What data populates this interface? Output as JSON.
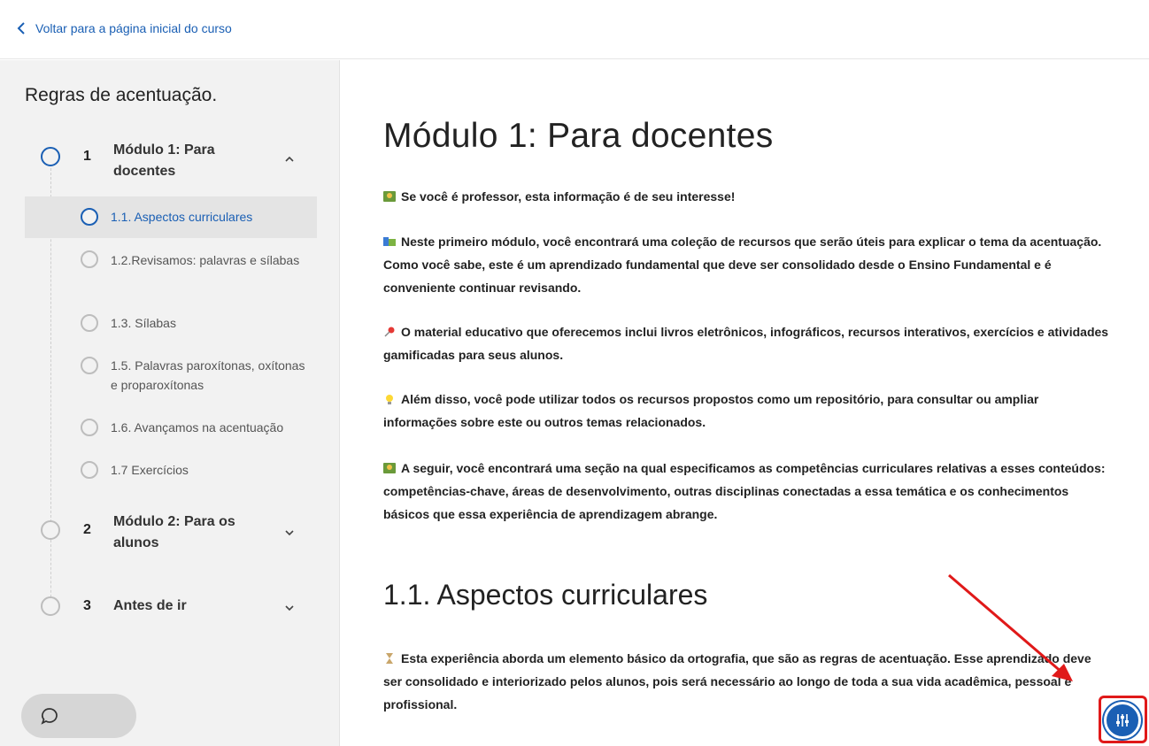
{
  "topbar": {
    "back_label": "Voltar para a página inicial do curso"
  },
  "sidebar": {
    "course_title": "Regras de acentuação.",
    "modules": [
      {
        "num": "1",
        "title": "Módulo 1: Para docentes",
        "expanded": true
      },
      {
        "num": "2",
        "title": "Módulo 2: Para os alunos",
        "expanded": false
      },
      {
        "num": "3",
        "title": "Antes de ir",
        "expanded": false
      }
    ],
    "lessons": [
      {
        "label": "1.1. Aspectos curriculares",
        "selected": true
      },
      {
        "label": "1.2.Revisamos: palavras e sílabas"
      },
      {
        "label": "1.3. Sílabas"
      },
      {
        "label": "1.5. Palavras paroxítonas, oxítonas e proparoxítonas"
      },
      {
        "label": "1.6. Avançamos na acentuação"
      },
      {
        "label": "1.7 Exercícios"
      }
    ]
  },
  "main": {
    "title": "Módulo 1: Para docentes",
    "paragraphs": [
      "Se você é professor, esta informação é de seu interesse!",
      "Neste primeiro módulo, você encontrará uma coleção de recursos que serão úteis para explicar o tema da acentuação. Como você sabe, este é um aprendizado fundamental que deve ser consolidado desde o Ensino Fundamental e é conveniente continuar revisando.",
      "O material educativo que oferecemos inclui livros eletrônicos, infográficos, recursos interativos, exercícios e atividades gamificadas para seus alunos.",
      "Além disso, você pode utilizar todos os recursos propostos como um repositório, para consultar ou ampliar informações sobre este ou outros temas relacionados.",
      "A seguir, você encontrará uma seção na qual especificamos as competências curriculares relativas a esses conteúdos: competências-chave, áreas de desenvolvimento, outras disciplinas conectadas a essa temática e os conhecimentos básicos que essa experiência de aprendizagem abrange."
    ],
    "section_title": "1.1. Aspectos curriculares",
    "section_paragraph": "Esta experiência aborda um elemento básico da ortografia, que são as regras de acentuação. Esse aprendizado deve ser consolidado e interiorizado pelos alunos, pois será necessário ao longo de toda a sua vida acadêmica, pessoal e profissional."
  },
  "icons": {
    "back": "chevron-left-icon",
    "chat": "chat-bubble-icon",
    "settings": "sliders-icon",
    "emojis": [
      "teacher-icon",
      "books-icon",
      "pin-icon",
      "lightbulb-icon",
      "teacher-icon",
      "hourglass-icon"
    ]
  },
  "colors": {
    "accent": "#1a5fb4",
    "highlight": "#e01919",
    "sidebar_bg": "#f2f2f2"
  }
}
